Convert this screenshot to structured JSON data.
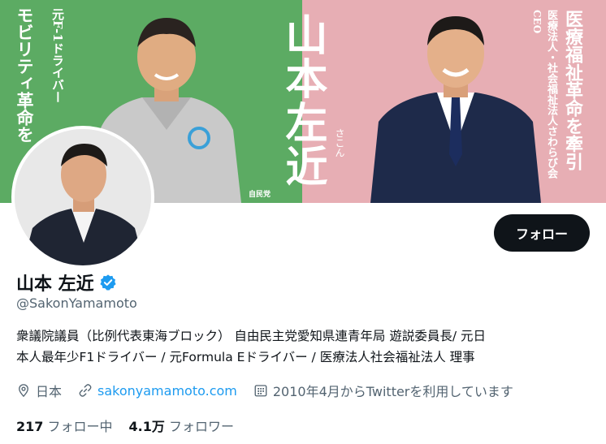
{
  "banner": {
    "left_vertical_small": "元F-1ドライバー",
    "left_vertical_large": "モビリティ革命を",
    "center_name": "山本左近",
    "center_kana": "さこん",
    "right_vertical_large": "医療福祉革命を牽引",
    "right_vertical_org": "医療法人・社会福祉法人さわらび会",
    "right_vertical_role": "CEO",
    "party_mark": "自民党",
    "colors": {
      "left": "#5cab63",
      "right": "#e7aeb4"
    }
  },
  "profile": {
    "display_name": "山本 左近",
    "verified_icon": "verified-badge-icon",
    "handle": "@SakonYamamoto",
    "bio_line1": "衆議院議員（比例代表東海ブロック） 自由民主党愛知県連青年局 遊説委員長/ 元日",
    "bio_line2": "本人最年少F1ドライバー / 元Formula Eドライバー / 医療法人社会福祉法人 理事",
    "location": "日本",
    "website": "sakonyamamoto.com",
    "joined": "2010年4月からTwitterを利用しています"
  },
  "actions": {
    "follow_label": "フォロー"
  },
  "stats": {
    "following_count": "217",
    "following_label": "フォロー中",
    "followers_count": "4.1万",
    "followers_label": "フォロワー"
  },
  "colors": {
    "accent": "#1d9bf0",
    "text": "#0f1419",
    "muted": "#536471"
  }
}
